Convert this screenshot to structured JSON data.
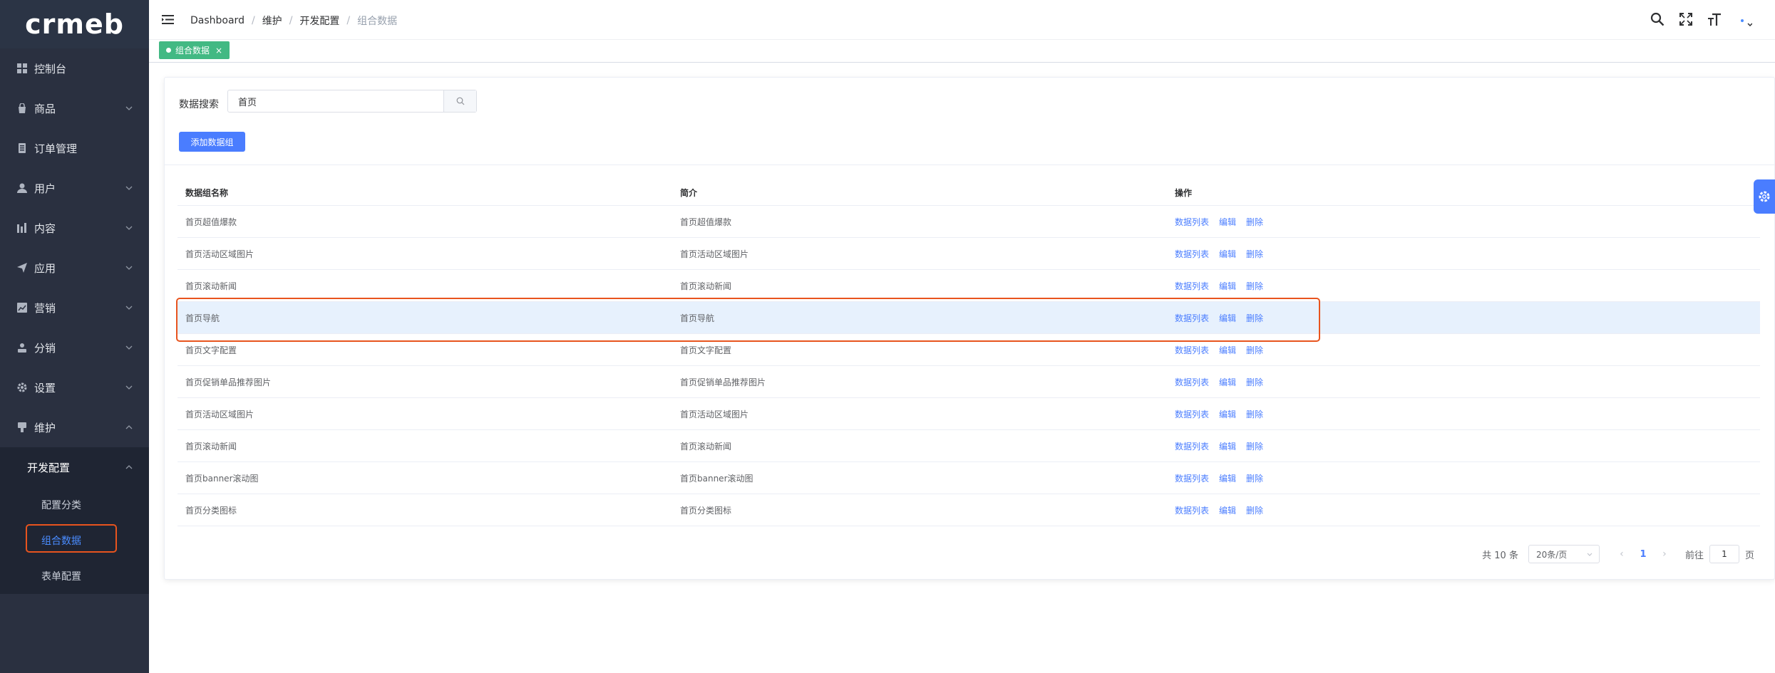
{
  "logo": {
    "text": "crmeb"
  },
  "sidebar": {
    "items": [
      {
        "label": "控制台",
        "icon": "dashboard-icon"
      },
      {
        "label": "商品",
        "icon": "bag-icon"
      },
      {
        "label": "订单管理",
        "icon": "order-icon"
      },
      {
        "label": "用户",
        "icon": "user-icon"
      },
      {
        "label": "内容",
        "icon": "chart-icon"
      },
      {
        "label": "应用",
        "icon": "send-icon"
      },
      {
        "label": "营销",
        "icon": "marketing-icon"
      },
      {
        "label": "分销",
        "icon": "distribution-icon"
      },
      {
        "label": "设置",
        "icon": "gear-icon"
      },
      {
        "label": "维护",
        "icon": "maintenance-icon"
      }
    ],
    "submenu": {
      "title": "开发配置",
      "items": [
        {
          "label": "配置分类"
        },
        {
          "label": "组合数据"
        },
        {
          "label": "表单配置"
        }
      ]
    }
  },
  "breadcrumb": [
    "Dashboard",
    "维护",
    "开发配置",
    "组合数据"
  ],
  "tag": {
    "label": "组合数据",
    "close": "×"
  },
  "search": {
    "label": "数据搜索",
    "value": "首页"
  },
  "add_button": "添加数据组",
  "table": {
    "headers": [
      "数据组名称",
      "简介",
      "操作"
    ],
    "rows": [
      {
        "name": "首页超值爆款",
        "intro": "首页超值爆款"
      },
      {
        "name": "首页活动区域图片",
        "intro": "首页活动区域图片"
      },
      {
        "name": "首页滚动新闻",
        "intro": "首页滚动新闻"
      },
      {
        "name": "首页导航",
        "intro": "首页导航"
      },
      {
        "name": "首页文字配置",
        "intro": "首页文字配置"
      },
      {
        "name": "首页促销单品推荐图片",
        "intro": "首页促销单品推荐图片"
      },
      {
        "name": "首页活动区域图片",
        "intro": "首页活动区域图片"
      },
      {
        "name": "首页滚动新闻",
        "intro": "首页滚动新闻"
      },
      {
        "name": "首页banner滚动图",
        "intro": "首页banner滚动图"
      },
      {
        "name": "首页分类图标",
        "intro": "首页分类图标"
      }
    ],
    "ops": [
      "数据列表",
      "编辑",
      "删除"
    ]
  },
  "pager": {
    "total": "共 10 条",
    "page_size": "20条/页",
    "current": "1",
    "goto_label": "前往",
    "goto_value": "1",
    "page_unit": "页"
  },
  "colors": {
    "sidebar": "#2a3040",
    "accent": "#4a7dff",
    "tag": "#42b983",
    "highlight": "#e8541e"
  }
}
